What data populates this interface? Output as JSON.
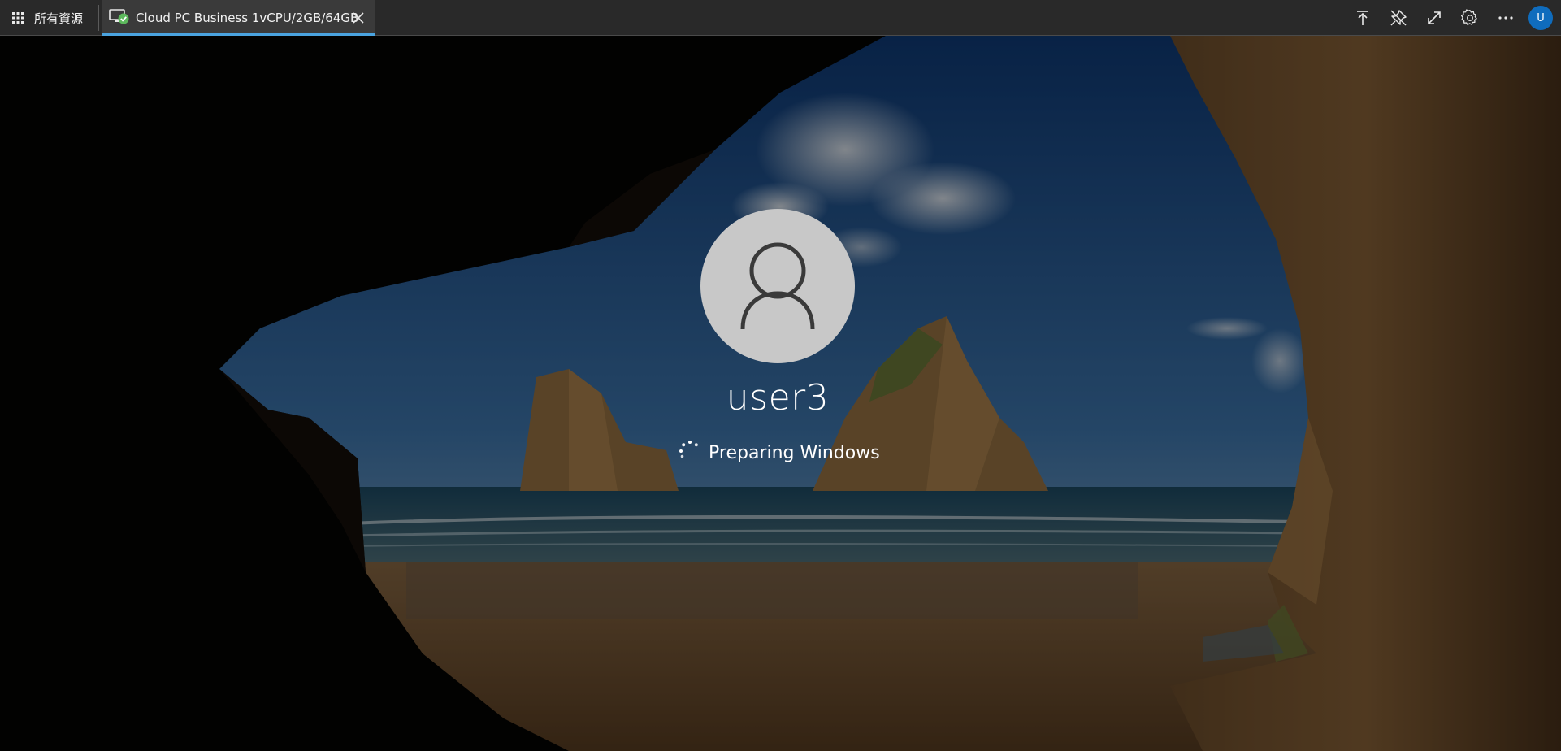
{
  "topbar": {
    "all_resources_label": "所有資源",
    "tab": {
      "label": "Cloud PC Business 1vCPU/2GB/64GB"
    },
    "avatar_initial": "U",
    "icons": [
      "grid-icon",
      "cloud-pc-icon",
      "close-icon",
      "upload-icon",
      "unpin-icon",
      "expand-icon",
      "settings-icon",
      "more-icon"
    ]
  },
  "lockscreen": {
    "username": "user3",
    "status_text": "Preparing Windows"
  },
  "colors": {
    "topbar_bg": "#292929",
    "tab_bg": "#3a3a3a",
    "tab_underline": "#4aa3df",
    "avatar_bg": "#0f6cbd",
    "user_avatar_bg": "#c8c8c8"
  }
}
